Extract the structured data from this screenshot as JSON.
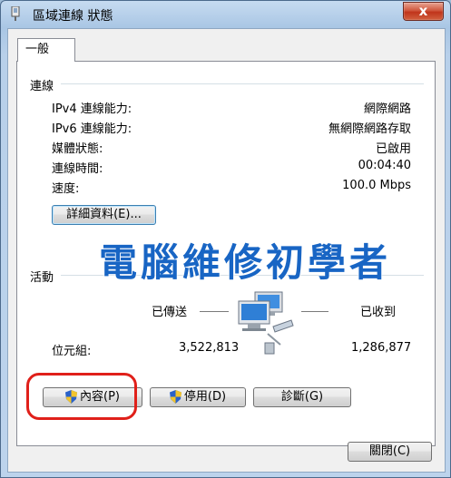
{
  "window": {
    "title": "區域連線 狀態",
    "close_symbol": "x"
  },
  "tabs": [
    {
      "label": "一般"
    }
  ],
  "connection": {
    "heading": "連線",
    "rows": [
      {
        "label": "IPv4 連線能力:",
        "value": "網際網路"
      },
      {
        "label": "IPv6 連線能力:",
        "value": "無網際網路存取"
      },
      {
        "label": "媒體狀態:",
        "value": "已啟用"
      },
      {
        "label": "連線時間:",
        "value": "00:04:40"
      },
      {
        "label": "速度:",
        "value": "100.0 Mbps"
      }
    ],
    "details_button": "詳細資料(E)..."
  },
  "watermark": "電腦維修初學者",
  "activity": {
    "heading": "活動",
    "sent_label": "已傳送",
    "received_label": "已收到",
    "bytes_label": "位元組:",
    "bytes_sent": "3,522,813",
    "bytes_received": "1,286,877"
  },
  "buttons": {
    "properties": "內容(P)",
    "disable": "停用(D)",
    "diagnose": "診斷(G)",
    "close": "關閉(C)"
  },
  "colors": {
    "watermark": "#1865c4",
    "highlight": "#e0201a"
  }
}
